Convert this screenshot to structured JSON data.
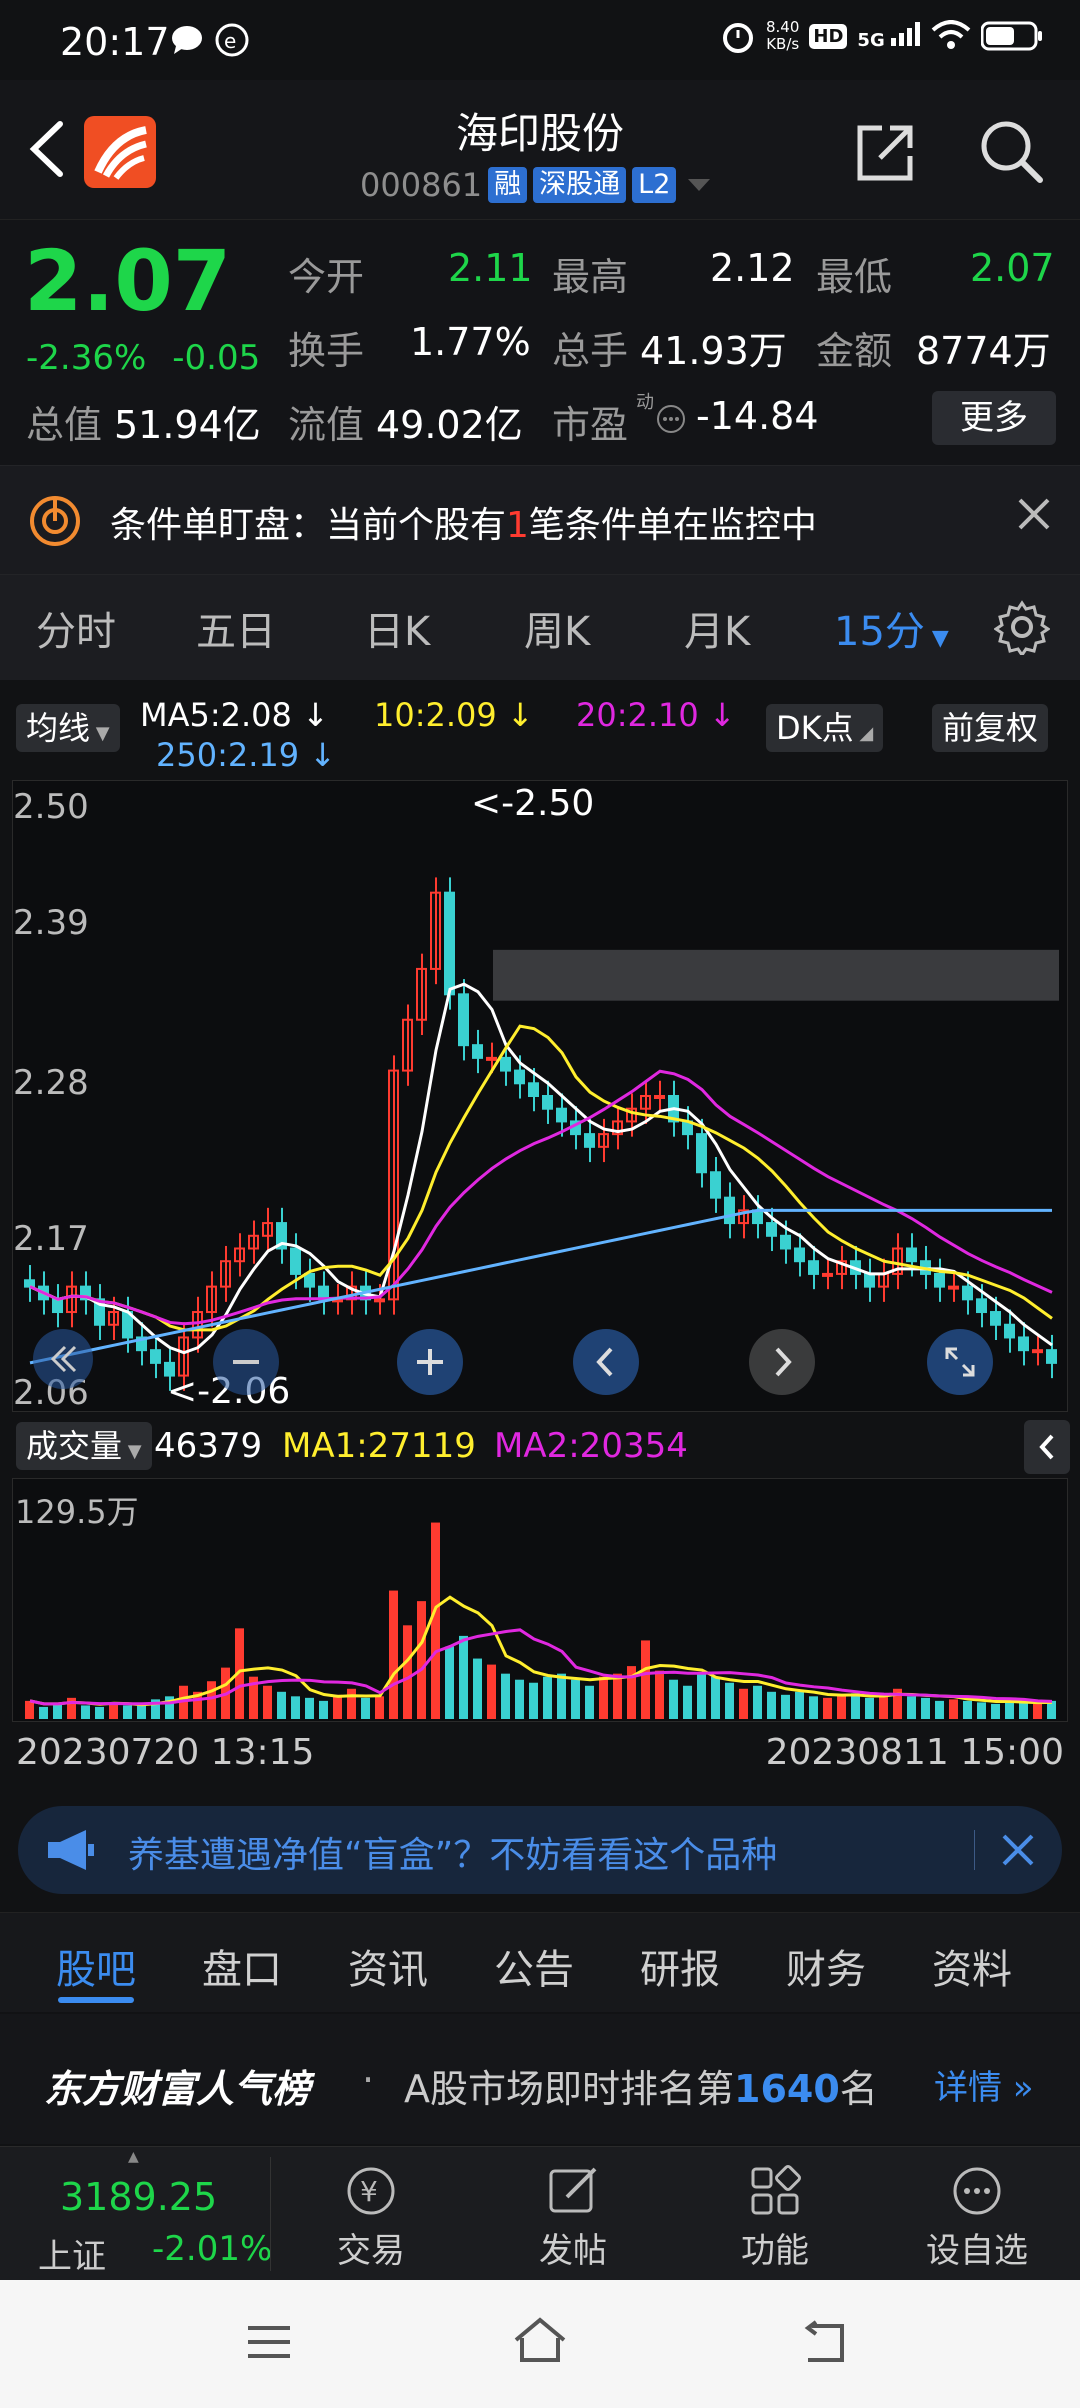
{
  "status": {
    "time": "20:17",
    "net_speed": "8.40",
    "net_unit": "KB/s",
    "hd": "HD",
    "signal": "5G"
  },
  "header": {
    "title": "海印股份",
    "code": "000861",
    "badges": [
      "融",
      "深股通",
      "L2"
    ]
  },
  "quote": {
    "price": "2.07",
    "change_pct": "-2.36%",
    "change": "-0.05",
    "open_label": "今开",
    "open": "2.11",
    "high_label": "最高",
    "high": "2.12",
    "low_label": "最低",
    "low": "2.07",
    "turnover_label": "换手",
    "turnover": "1.77%",
    "volume_label": "总手",
    "volume": "41.93万",
    "amount_label": "金额",
    "amount": "8774万",
    "mktcap_label": "总值",
    "mktcap": "51.94亿",
    "float_label": "流值",
    "float": "49.02亿",
    "pe_label": "市盈",
    "pe_sup": "动",
    "pe": "-14.84",
    "more": "更多"
  },
  "alert": {
    "prefix": "条件单盯盘：当前个股有",
    "count": "1",
    "suffix": "笔条件单在监控中"
  },
  "periods": [
    "分时",
    "五日",
    "日K",
    "周K",
    "月K",
    "15分"
  ],
  "ma_legend": {
    "type": "均线",
    "ma5": "MA5:2.08",
    "ma10": "10:2.09",
    "ma20": "20:2.10",
    "ma250": "250:2.19",
    "dk": "DK点",
    "adj": "前复权"
  },
  "chart": {
    "y_labels": [
      "2.50",
      "2.39",
      "2.28",
      "2.17",
      "2.06"
    ],
    "high_note": "<-2.50",
    "low_note": "<-2.06"
  },
  "volume": {
    "label": "成交量",
    "val": "46379",
    "ma1": "MA1:27119",
    "ma2": "MA2:20354",
    "max": "129.5万"
  },
  "dates": {
    "start": "20230720 13:15",
    "end": "20230811 15:00"
  },
  "ad": {
    "text": "养基遭遇净值“盲盒”？不妨看看这个品种"
  },
  "bottom_tabs": [
    "股吧",
    "盘口",
    "资讯",
    "公告",
    "研报",
    "财务",
    "资料"
  ],
  "rank": {
    "brand": "东方财富人气榜",
    "text": "A股市场即时排名第",
    "num": "1640",
    "unit": "名",
    "detail": "详情"
  },
  "index": {
    "value": "3189.25",
    "name": "上证",
    "pct": "-2.01%"
  },
  "toolbar": [
    "交易",
    "发帖",
    "功能",
    "设自选"
  ],
  "colors": {
    "up": "#ff3b30",
    "down": "#1ed64a",
    "ma5": "#ffffff",
    "ma10": "#ffee2e",
    "ma20": "#e028e0",
    "ma250": "#62b3ff",
    "accent": "#3b8cf0"
  },
  "chart_data": {
    "type": "candlestick",
    "y_range": [
      2.04,
      2.52
    ],
    "close": [
      2.13,
      2.12,
      2.11,
      2.13,
      2.12,
      2.1,
      2.11,
      2.09,
      2.08,
      2.07,
      2.06,
      2.09,
      2.11,
      2.13,
      2.15,
      2.16,
      2.17,
      2.18,
      2.16,
      2.14,
      2.13,
      2.12,
      2.12,
      2.13,
      2.12,
      2.12,
      2.3,
      2.34,
      2.38,
      2.44,
      2.36,
      2.32,
      2.31,
      2.31,
      2.3,
      2.29,
      2.28,
      2.27,
      2.26,
      2.25,
      2.24,
      2.25,
      2.26,
      2.27,
      2.28,
      2.28,
      2.26,
      2.25,
      2.22,
      2.2,
      2.18,
      2.19,
      2.18,
      2.17,
      2.16,
      2.15,
      2.14,
      2.14,
      2.15,
      2.14,
      2.13,
      2.14,
      2.16,
      2.15,
      2.14,
      2.13,
      2.13,
      2.12,
      2.11,
      2.1,
      2.09,
      2.08,
      2.08,
      2.07
    ],
    "vol": [
      12,
      8,
      10,
      14,
      9,
      8,
      11,
      9,
      10,
      13,
      15,
      22,
      18,
      25,
      34,
      60,
      28,
      22,
      18,
      15,
      14,
      12,
      16,
      20,
      14,
      15,
      85,
      62,
      78,
      130,
      48,
      55,
      40,
      36,
      30,
      26,
      24,
      28,
      30,
      26,
      22,
      28,
      30,
      35,
      52,
      32,
      26,
      22,
      30,
      28,
      24,
      20,
      22,
      18,
      16,
      18,
      15,
      14,
      16,
      17,
      14,
      15,
      20,
      15,
      14,
      12,
      13,
      12,
      11,
      10,
      12,
      11,
      10,
      12
    ]
  }
}
